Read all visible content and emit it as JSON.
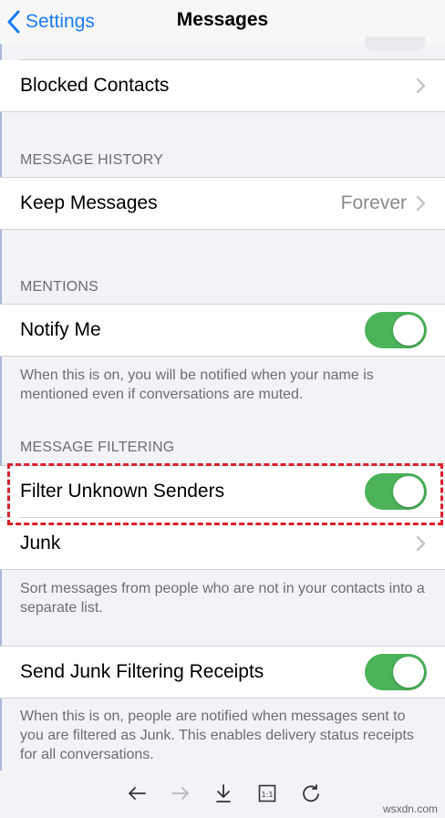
{
  "nav": {
    "back_label": "Settings",
    "title": "Messages"
  },
  "rows": {
    "blocked": {
      "label": "Blocked Contacts"
    },
    "keep": {
      "label": "Keep Messages",
      "value": "Forever"
    },
    "notify": {
      "label": "Notify Me",
      "on": true
    },
    "filter": {
      "label": "Filter Unknown Senders",
      "on": true
    },
    "junk": {
      "label": "Junk"
    },
    "receipts": {
      "label": "Send Junk Filtering Receipts",
      "on": true
    }
  },
  "sections": {
    "history": "MESSAGE HISTORY",
    "mentions": "MENTIONS",
    "filtering": "MESSAGE FILTERING"
  },
  "footers": {
    "mentions": "When this is on, you will be notified when your name is mentioned even if conversations are muted.",
    "filtering": "Sort messages from people who are not in your contacts into a separate list.",
    "receipts": "When this is on, people are notified when messages sent to you are filtered as Junk. This enables delivery status receipts for all conversations."
  },
  "toolbar": {
    "icons": [
      "back-arrow-icon",
      "forward-arrow-icon",
      "download-icon",
      "actual-size-icon",
      "refresh-icon"
    ],
    "actual_size_label": "1:1"
  },
  "watermark": "wsxdn.com",
  "colors": {
    "accent": "#1a7cf5",
    "toggle_on": "#4cb35b",
    "highlight": "#e0202c"
  }
}
